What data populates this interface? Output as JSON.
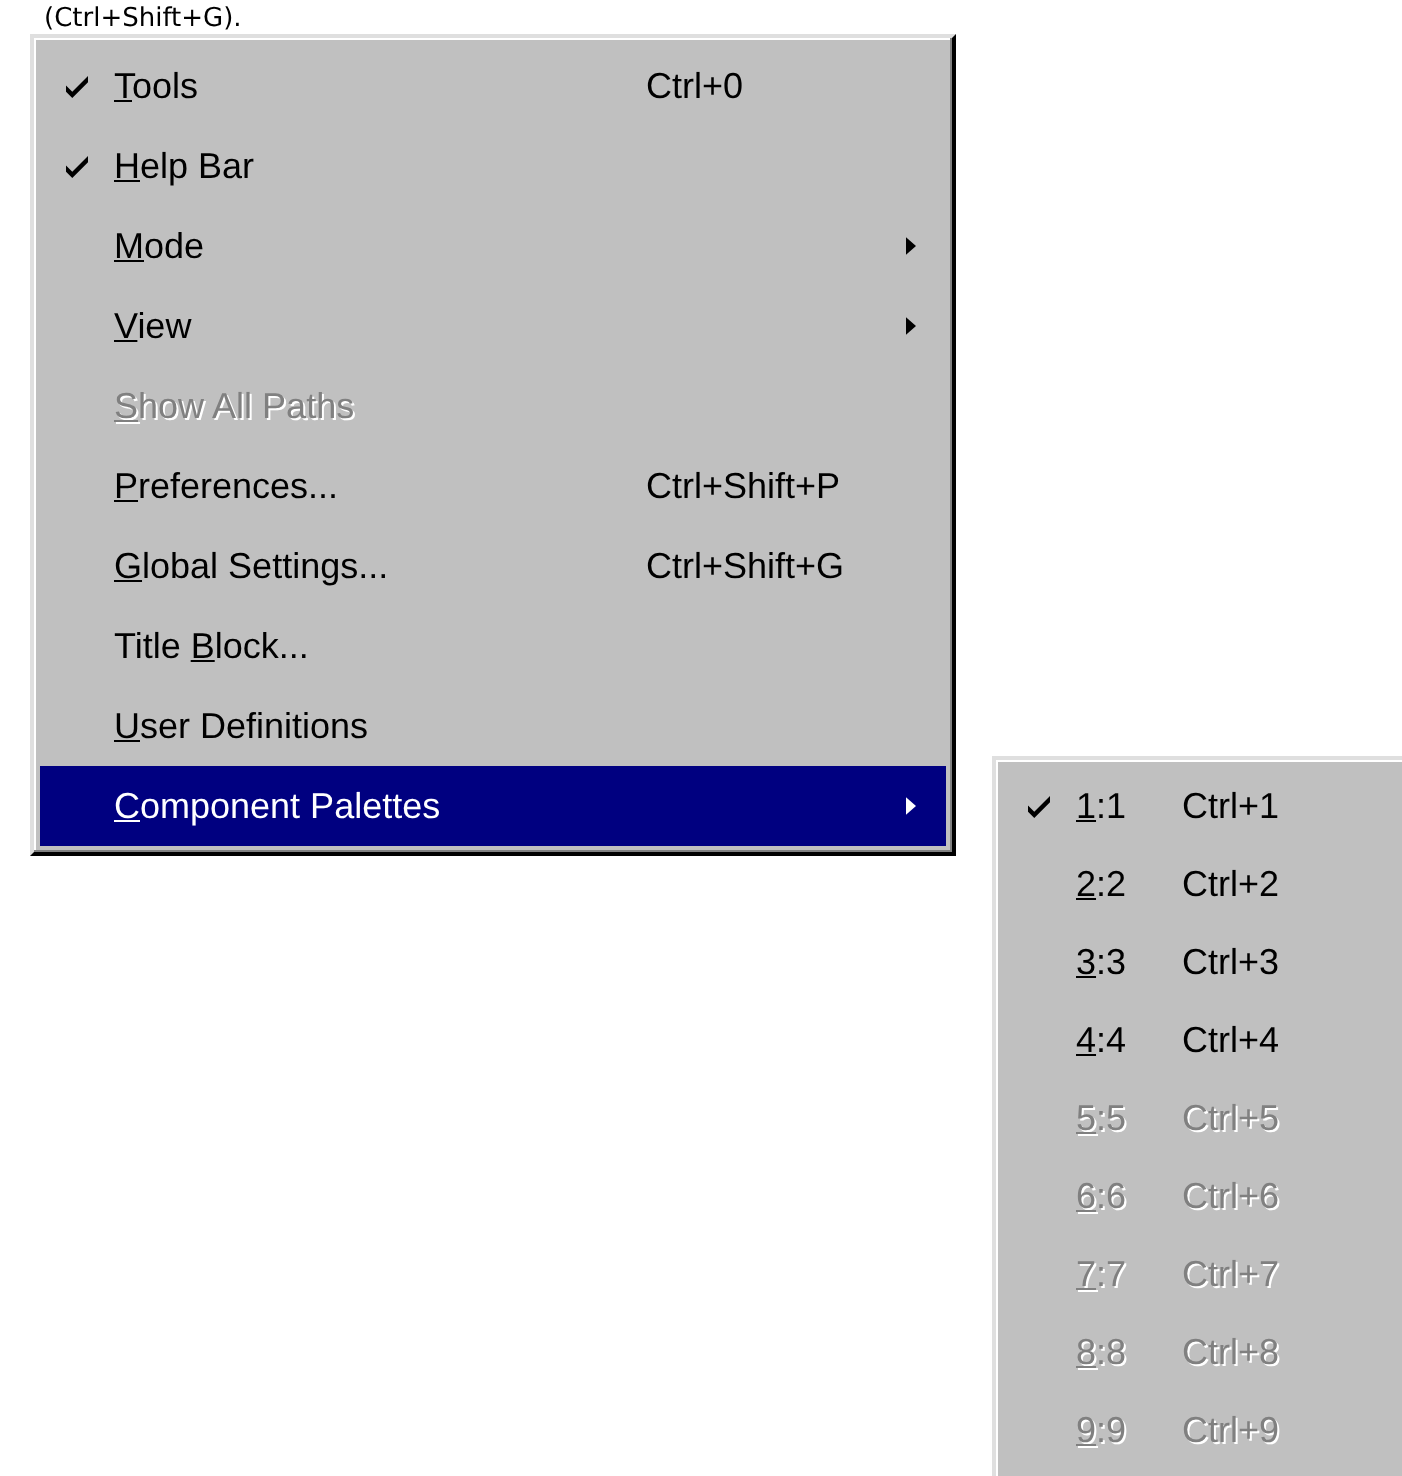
{
  "caption": "(Ctrl+Shift+G).",
  "menu": {
    "items": [
      {
        "key": "T",
        "post": "ools",
        "shortcut": "Ctrl+0",
        "checked": true,
        "disabled": false,
        "submenu": false,
        "selected": false
      },
      {
        "key": "H",
        "post": "elp Bar",
        "checked": true,
        "disabled": false,
        "submenu": false,
        "selected": false
      },
      {
        "key": "M",
        "post": "ode",
        "checked": false,
        "disabled": false,
        "submenu": true,
        "selected": false
      },
      {
        "key": "V",
        "post": "iew",
        "checked": false,
        "disabled": false,
        "submenu": true,
        "selected": false
      },
      {
        "key": "S",
        "post": "how All Paths",
        "checked": false,
        "disabled": true,
        "submenu": false,
        "selected": false
      },
      {
        "key": "P",
        "post": "references...",
        "shortcut": "Ctrl+Shift+P",
        "checked": false,
        "disabled": false,
        "submenu": false,
        "selected": false
      },
      {
        "key": "G",
        "post": "lobal Settings...",
        "shortcut": "Ctrl+Shift+G",
        "checked": false,
        "disabled": false,
        "submenu": false,
        "selected": false
      },
      {
        "pre": "Title ",
        "key": "B",
        "post": "lock...",
        "checked": false,
        "disabled": false,
        "submenu": false,
        "selected": false
      },
      {
        "key": "U",
        "post": "ser Definitions",
        "checked": false,
        "disabled": false,
        "submenu": false,
        "selected": false
      },
      {
        "key": "C",
        "post": "omponent Palettes",
        "checked": false,
        "disabled": false,
        "submenu": true,
        "selected": true
      }
    ]
  },
  "submenu": {
    "items": [
      {
        "key": "1",
        "post": ":1",
        "shortcut": "Ctrl+1",
        "checked": true,
        "disabled": false
      },
      {
        "key": "2",
        "post": ":2",
        "shortcut": "Ctrl+2",
        "checked": false,
        "disabled": false
      },
      {
        "key": "3",
        "post": ":3",
        "shortcut": "Ctrl+3",
        "checked": false,
        "disabled": false
      },
      {
        "key": "4",
        "post": ":4",
        "shortcut": "Ctrl+4",
        "checked": false,
        "disabled": false
      },
      {
        "key": "5",
        "post": ":5",
        "shortcut": "Ctrl+5",
        "checked": false,
        "disabled": true
      },
      {
        "key": "6",
        "post": ":6",
        "shortcut": "Ctrl+6",
        "checked": false,
        "disabled": true
      },
      {
        "key": "7",
        "post": ":7",
        "shortcut": "Ctrl+7",
        "checked": false,
        "disabled": true
      },
      {
        "key": "8",
        "post": ":8",
        "shortcut": "Ctrl+8",
        "checked": false,
        "disabled": true
      },
      {
        "key": "9",
        "post": ":9",
        "shortcut": "Ctrl+9",
        "checked": false,
        "disabled": true
      }
    ]
  }
}
